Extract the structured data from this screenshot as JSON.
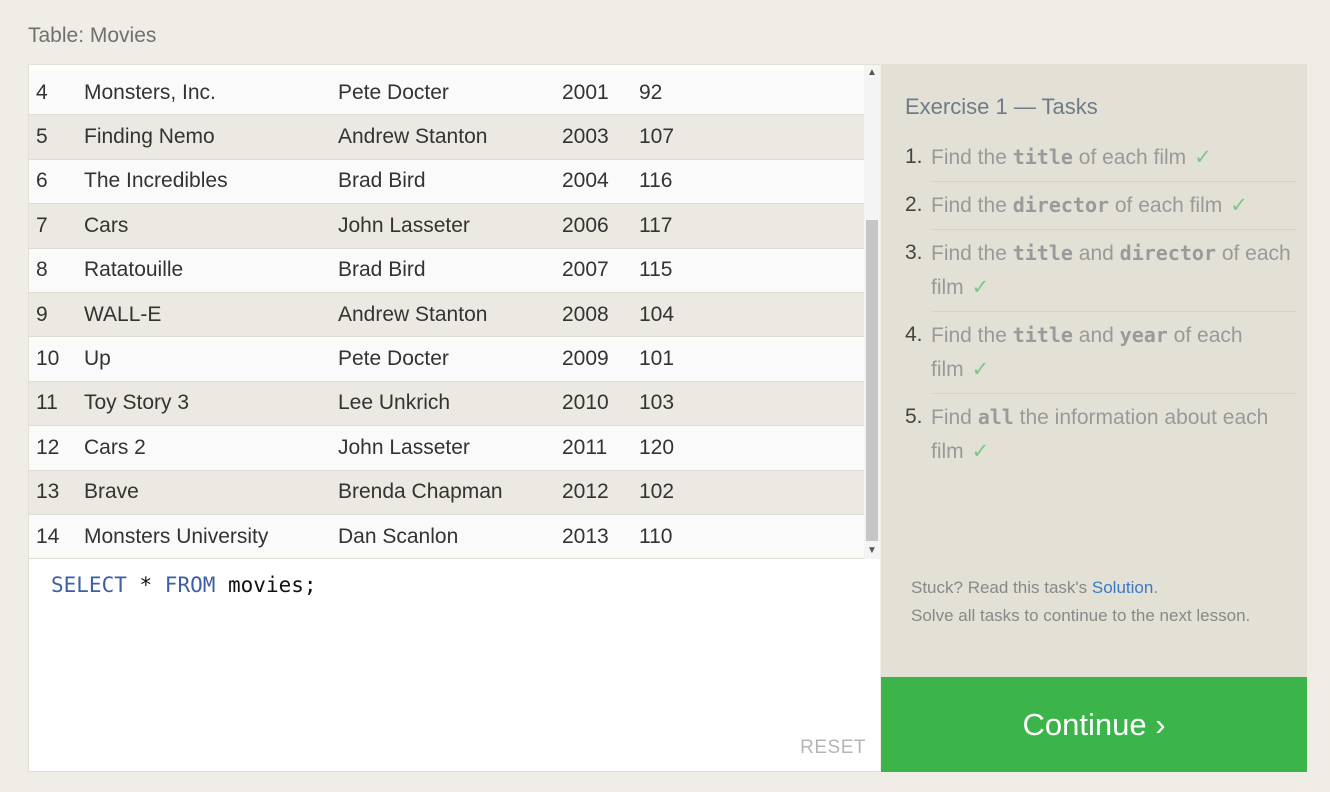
{
  "page": {
    "title": "Table: Movies"
  },
  "table": {
    "rows": [
      {
        "id": "4",
        "title": "Monsters, Inc.",
        "director": "Pete Docter",
        "year": "2001",
        "length": "92"
      },
      {
        "id": "5",
        "title": "Finding Nemo",
        "director": "Andrew Stanton",
        "year": "2003",
        "length": "107"
      },
      {
        "id": "6",
        "title": "The Incredibles",
        "director": "Brad Bird",
        "year": "2004",
        "length": "116"
      },
      {
        "id": "7",
        "title": "Cars",
        "director": "John Lasseter",
        "year": "2006",
        "length": "117"
      },
      {
        "id": "8",
        "title": "Ratatouille",
        "director": "Brad Bird",
        "year": "2007",
        "length": "115"
      },
      {
        "id": "9",
        "title": "WALL-E",
        "director": "Andrew Stanton",
        "year": "2008",
        "length": "104"
      },
      {
        "id": "10",
        "title": "Up",
        "director": "Pete Docter",
        "year": "2009",
        "length": "101"
      },
      {
        "id": "11",
        "title": "Toy Story 3",
        "director": "Lee Unkrich",
        "year": "2010",
        "length": "103"
      },
      {
        "id": "12",
        "title": "Cars 2",
        "director": "John Lasseter",
        "year": "2011",
        "length": "120"
      },
      {
        "id": "13",
        "title": "Brave",
        "director": "Brenda Chapman",
        "year": "2012",
        "length": "102"
      },
      {
        "id": "14",
        "title": "Monsters University",
        "director": "Dan Scanlon",
        "year": "2013",
        "length": "110"
      }
    ]
  },
  "editor": {
    "kw_select": "SELECT",
    "star": " * ",
    "kw_from": "FROM",
    "rest": " movies;",
    "reset_label": "RESET"
  },
  "tasks": {
    "title": "Exercise 1 — Tasks",
    "items": [
      {
        "num": "1.",
        "parts": [
          "Find the ",
          "title",
          " of each film"
        ]
      },
      {
        "num": "2.",
        "parts": [
          "Find the ",
          "director",
          " of each film"
        ]
      },
      {
        "num": "3.",
        "parts": [
          "Find the ",
          "title",
          " and ",
          "director",
          " of each film"
        ]
      },
      {
        "num": "4.",
        "parts": [
          "Find the ",
          "title",
          " and ",
          "year",
          " of each film"
        ]
      },
      {
        "num": "5.",
        "parts": [
          "Find ",
          "all",
          " the information about each film"
        ]
      }
    ],
    "check_glyph": "✓"
  },
  "help": {
    "stuck_prefix": "Stuck? Read this task's ",
    "solution_link": "Solution",
    "stuck_suffix": ".",
    "line2": "Solve all tasks to continue to the next lesson."
  },
  "continue_button": {
    "label": "Continue ›"
  },
  "colors": {
    "continue_green": "#3bb54a",
    "keyword_blue": "#3e5ea6",
    "check_green": "#7bc78a",
    "link_blue": "#3c78c8"
  }
}
